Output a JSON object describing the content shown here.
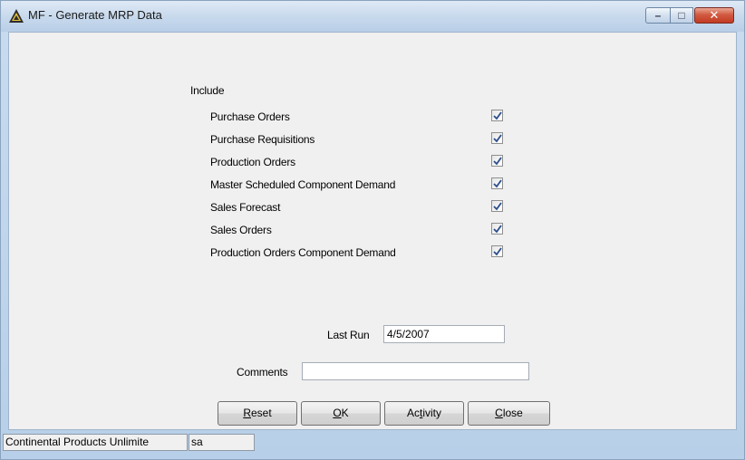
{
  "window": {
    "title": "MF - Generate MRP Data",
    "minimize_glyph": "–",
    "maximize_glyph": "□",
    "close_glyph": "✕"
  },
  "include": {
    "heading": "Include",
    "options": [
      {
        "label": "Purchase Orders",
        "checked": true
      },
      {
        "label": "Purchase Requisitions",
        "checked": true
      },
      {
        "label": "Production Orders",
        "checked": true
      },
      {
        "label": "Master Scheduled Component Demand",
        "checked": true
      },
      {
        "label": "Sales Forecast",
        "checked": true
      },
      {
        "label": "Sales Orders",
        "checked": true
      },
      {
        "label": "Production Orders Component Demand",
        "checked": true
      }
    ]
  },
  "last_run": {
    "label": "Last Run",
    "value": "4/5/2007"
  },
  "comments": {
    "label": "Comments",
    "value": ""
  },
  "buttons": {
    "reset": {
      "accel": "R",
      "rest": "eset"
    },
    "ok": {
      "accel": "O",
      "rest": "K"
    },
    "activity": {
      "pre": "Ac",
      "accel": "t",
      "rest": "ivity"
    },
    "close": {
      "accel": "C",
      "rest": "lose"
    }
  },
  "status": {
    "company": "Continental Products Unlimite",
    "user": "sa"
  },
  "colors": {
    "frame": "#b7cfe8",
    "content_bg": "#f0f0f0",
    "check_mark": "#2b4d8c"
  }
}
